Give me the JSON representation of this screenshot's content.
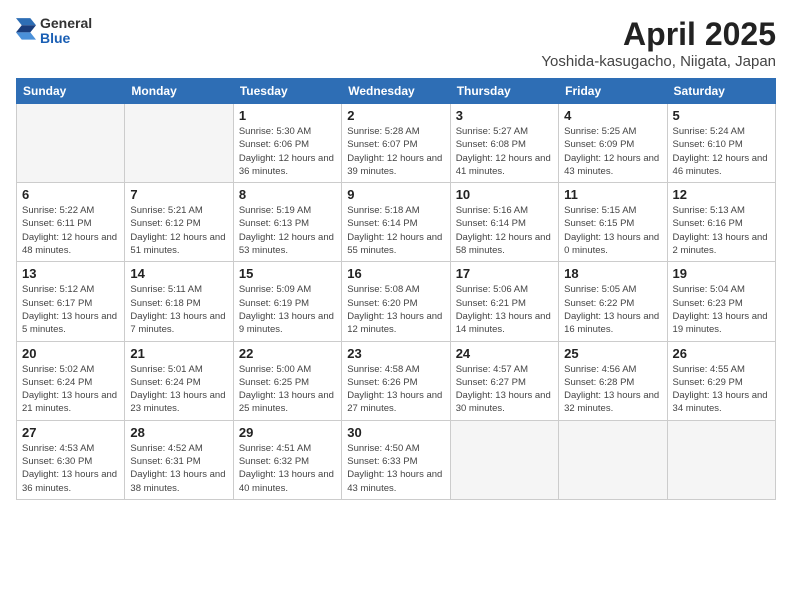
{
  "header": {
    "logo_general": "General",
    "logo_blue": "Blue",
    "month_title": "April 2025",
    "location": "Yoshida-kasugacho, Niigata, Japan"
  },
  "weekdays": [
    "Sunday",
    "Monday",
    "Tuesday",
    "Wednesday",
    "Thursday",
    "Friday",
    "Saturday"
  ],
  "weeks": [
    [
      {
        "day": "",
        "info": ""
      },
      {
        "day": "",
        "info": ""
      },
      {
        "day": "1",
        "info": "Sunrise: 5:30 AM\nSunset: 6:06 PM\nDaylight: 12 hours and 36 minutes."
      },
      {
        "day": "2",
        "info": "Sunrise: 5:28 AM\nSunset: 6:07 PM\nDaylight: 12 hours and 39 minutes."
      },
      {
        "day": "3",
        "info": "Sunrise: 5:27 AM\nSunset: 6:08 PM\nDaylight: 12 hours and 41 minutes."
      },
      {
        "day": "4",
        "info": "Sunrise: 5:25 AM\nSunset: 6:09 PM\nDaylight: 12 hours and 43 minutes."
      },
      {
        "day": "5",
        "info": "Sunrise: 5:24 AM\nSunset: 6:10 PM\nDaylight: 12 hours and 46 minutes."
      }
    ],
    [
      {
        "day": "6",
        "info": "Sunrise: 5:22 AM\nSunset: 6:11 PM\nDaylight: 12 hours and 48 minutes."
      },
      {
        "day": "7",
        "info": "Sunrise: 5:21 AM\nSunset: 6:12 PM\nDaylight: 12 hours and 51 minutes."
      },
      {
        "day": "8",
        "info": "Sunrise: 5:19 AM\nSunset: 6:13 PM\nDaylight: 12 hours and 53 minutes."
      },
      {
        "day": "9",
        "info": "Sunrise: 5:18 AM\nSunset: 6:14 PM\nDaylight: 12 hours and 55 minutes."
      },
      {
        "day": "10",
        "info": "Sunrise: 5:16 AM\nSunset: 6:14 PM\nDaylight: 12 hours and 58 minutes."
      },
      {
        "day": "11",
        "info": "Sunrise: 5:15 AM\nSunset: 6:15 PM\nDaylight: 13 hours and 0 minutes."
      },
      {
        "day": "12",
        "info": "Sunrise: 5:13 AM\nSunset: 6:16 PM\nDaylight: 13 hours and 2 minutes."
      }
    ],
    [
      {
        "day": "13",
        "info": "Sunrise: 5:12 AM\nSunset: 6:17 PM\nDaylight: 13 hours and 5 minutes."
      },
      {
        "day": "14",
        "info": "Sunrise: 5:11 AM\nSunset: 6:18 PM\nDaylight: 13 hours and 7 minutes."
      },
      {
        "day": "15",
        "info": "Sunrise: 5:09 AM\nSunset: 6:19 PM\nDaylight: 13 hours and 9 minutes."
      },
      {
        "day": "16",
        "info": "Sunrise: 5:08 AM\nSunset: 6:20 PM\nDaylight: 13 hours and 12 minutes."
      },
      {
        "day": "17",
        "info": "Sunrise: 5:06 AM\nSunset: 6:21 PM\nDaylight: 13 hours and 14 minutes."
      },
      {
        "day": "18",
        "info": "Sunrise: 5:05 AM\nSunset: 6:22 PM\nDaylight: 13 hours and 16 minutes."
      },
      {
        "day": "19",
        "info": "Sunrise: 5:04 AM\nSunset: 6:23 PM\nDaylight: 13 hours and 19 minutes."
      }
    ],
    [
      {
        "day": "20",
        "info": "Sunrise: 5:02 AM\nSunset: 6:24 PM\nDaylight: 13 hours and 21 minutes."
      },
      {
        "day": "21",
        "info": "Sunrise: 5:01 AM\nSunset: 6:24 PM\nDaylight: 13 hours and 23 minutes."
      },
      {
        "day": "22",
        "info": "Sunrise: 5:00 AM\nSunset: 6:25 PM\nDaylight: 13 hours and 25 minutes."
      },
      {
        "day": "23",
        "info": "Sunrise: 4:58 AM\nSunset: 6:26 PM\nDaylight: 13 hours and 27 minutes."
      },
      {
        "day": "24",
        "info": "Sunrise: 4:57 AM\nSunset: 6:27 PM\nDaylight: 13 hours and 30 minutes."
      },
      {
        "day": "25",
        "info": "Sunrise: 4:56 AM\nSunset: 6:28 PM\nDaylight: 13 hours and 32 minutes."
      },
      {
        "day": "26",
        "info": "Sunrise: 4:55 AM\nSunset: 6:29 PM\nDaylight: 13 hours and 34 minutes."
      }
    ],
    [
      {
        "day": "27",
        "info": "Sunrise: 4:53 AM\nSunset: 6:30 PM\nDaylight: 13 hours and 36 minutes."
      },
      {
        "day": "28",
        "info": "Sunrise: 4:52 AM\nSunset: 6:31 PM\nDaylight: 13 hours and 38 minutes."
      },
      {
        "day": "29",
        "info": "Sunrise: 4:51 AM\nSunset: 6:32 PM\nDaylight: 13 hours and 40 minutes."
      },
      {
        "day": "30",
        "info": "Sunrise: 4:50 AM\nSunset: 6:33 PM\nDaylight: 13 hours and 43 minutes."
      },
      {
        "day": "",
        "info": ""
      },
      {
        "day": "",
        "info": ""
      },
      {
        "day": "",
        "info": ""
      }
    ]
  ]
}
